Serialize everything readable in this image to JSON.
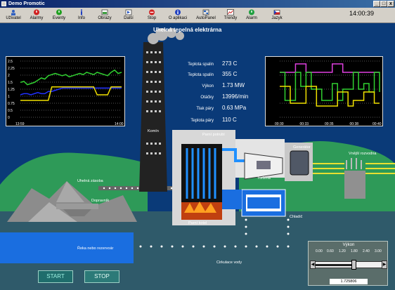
{
  "window": {
    "title": "Demo Promotic",
    "minimize": "_",
    "maximize": "□",
    "close": "x"
  },
  "toolbar": {
    "items": [
      {
        "label": "Uživatel",
        "icon": "user-icon"
      },
      {
        "label": "Alarmy",
        "icon": "alarm-icon"
      },
      {
        "label": "Eventy",
        "icon": "events-icon"
      },
      {
        "label": "Info",
        "icon": "info-icon"
      },
      {
        "label": "Obrazy",
        "icon": "images-icon"
      },
      {
        "label": "Další",
        "icon": "next-icon"
      },
      {
        "label": "Stop",
        "icon": "stop-icon"
      },
      {
        "label": "O aplikaci",
        "icon": "about-icon"
      },
      {
        "label": "AutoPanel",
        "icon": "autopanel-icon"
      },
      {
        "label": "Trendy",
        "icon": "trends-icon"
      },
      {
        "label": "Alarm",
        "icon": "alarm-bell-icon"
      },
      {
        "label": "Jazyk",
        "icon": "language-icon"
      }
    ],
    "clock": "14:00:39"
  },
  "page": {
    "title": "Uhelná tepelná elektrárna"
  },
  "readouts": [
    {
      "label": "Teplota spalin",
      "value": "273 C"
    },
    {
      "label": "Teplota spalin",
      "value": "355 C"
    },
    {
      "label": "Výkon",
      "value": "1.73 MW"
    },
    {
      "label": "Otáčky",
      "value": "13996/min"
    },
    {
      "label": "Tlak páry",
      "value": "0.63 MPa"
    },
    {
      "label": "Teplota páry",
      "value": "110 C"
    }
  ],
  "labels": {
    "chimney": "Komín",
    "steam_pipe": "Parní potrubí",
    "generator": "Generátor",
    "substation": "Vnější rozvodna",
    "coal_store": "Uhelná zásoba",
    "conveyor": "Dopravník",
    "turbine": "Turbína",
    "boiler": "Parní kotel",
    "cooler": "Chladič",
    "river": "Řeka nebo rezervoár",
    "water_circulation": "Cirkulace vody"
  },
  "buttons": {
    "start": "START",
    "stop": "STOP"
  },
  "power_panel": {
    "title": "Výkon",
    "ticks": [
      "0.00",
      "0.60",
      "1.20",
      "1.80",
      "2.40",
      "3.00"
    ],
    "value": 1.725806,
    "value_text": "1.725806",
    "min": 0,
    "max": 3
  },
  "colors": {
    "sky": "#0a3a78",
    "hill": "#2e9a58",
    "water": "#1a6ee0",
    "ground": "#2f5a6a",
    "trend_green": "#30d030",
    "trend_blue": "#2030ff",
    "trend_yellow": "#f0e000",
    "trend_magenta": "#e040e0"
  },
  "chart_data": [
    {
      "type": "line",
      "x_tick_labels": [
        "13:59",
        "14:00"
      ],
      "y_tick_labels": [
        "0",
        "0.5",
        "0.75",
        "1",
        "1.25",
        "1.5",
        "2",
        "2.25",
        "2.5"
      ],
      "ylim": [
        0,
        2.5
      ],
      "series": [
        {
          "color": "#30d030",
          "values": [
            1.55,
            1.6,
            1.45,
            1.5,
            1.55,
            1.65,
            1.75,
            1.7,
            1.85,
            1.9,
            1.95,
            1.9,
            1.85,
            1.9,
            1.8,
            1.85,
            1.9,
            1.95,
            1.9,
            2.0,
            1.95,
            1.9,
            2.0,
            1.95,
            1.9,
            1.85,
            2.0,
            2.1,
            1.95,
            2.0
          ]
        },
        {
          "color": "#2030ff",
          "values": [
            1.0,
            1.05,
            1.05,
            1.0,
            1.05,
            1.1,
            1.05,
            1.05,
            1.15,
            1.15,
            1.2,
            1.25,
            1.3,
            1.3,
            1.3,
            1.3,
            1.3,
            1.3,
            1.3,
            1.3,
            1.3,
            1.3,
            1.3,
            1.3,
            1.3,
            1.3,
            1.3,
            1.3,
            1.3,
            1.3
          ]
        },
        {
          "color": "#f0e000",
          "values": [
            0.75,
            0.75,
            0.75,
            0.75,
            0.75,
            0.75,
            0.75,
            0.75,
            0.75,
            1.35,
            1.35,
            1.35,
            1.35,
            1.35,
            1.35,
            1.35,
            1.35,
            1.35,
            1.35,
            1.35,
            1.35,
            1.35,
            1.0,
            1.0,
            1.0,
            1.0,
            1.35,
            1.35,
            1.35,
            1.35
          ]
        }
      ]
    },
    {
      "type": "line",
      "x_tick_labels": [
        "00:30",
        "00:33",
        "00:35",
        "00:38",
        "00:40"
      ],
      "y_tick_labels": [],
      "ylim": [
        0,
        1
      ],
      "series": [
        {
          "color": "#e040e0",
          "values": [
            0.8,
            0.8,
            0.8,
            0.95,
            0.95,
            0.8,
            0.8,
            0.8,
            0.8,
            0.8,
            0.95,
            0.95,
            0.8,
            0.8,
            0.8,
            0.8,
            0.8,
            0.8,
            0.8,
            0.8
          ]
        },
        {
          "color": "#30d030",
          "values": [
            0.8,
            0.3,
            0.3,
            0.8,
            0.55,
            0.8,
            0.5,
            0.5,
            0.3,
            0.3,
            0.6,
            0.3,
            0.5,
            0.5,
            0.8,
            0.5,
            0.6,
            0.45,
            0.8,
            0.45
          ]
        },
        {
          "color": "#f0e000",
          "values": [
            0.55,
            0.55,
            0.25,
            0.25,
            0.25,
            0.55,
            0.55,
            0.2,
            0.2,
            0.2,
            0.2,
            0.45,
            0.45,
            0.2,
            0.3,
            0.3,
            0.45,
            0.45,
            0.25,
            0.25
          ]
        }
      ]
    }
  ]
}
